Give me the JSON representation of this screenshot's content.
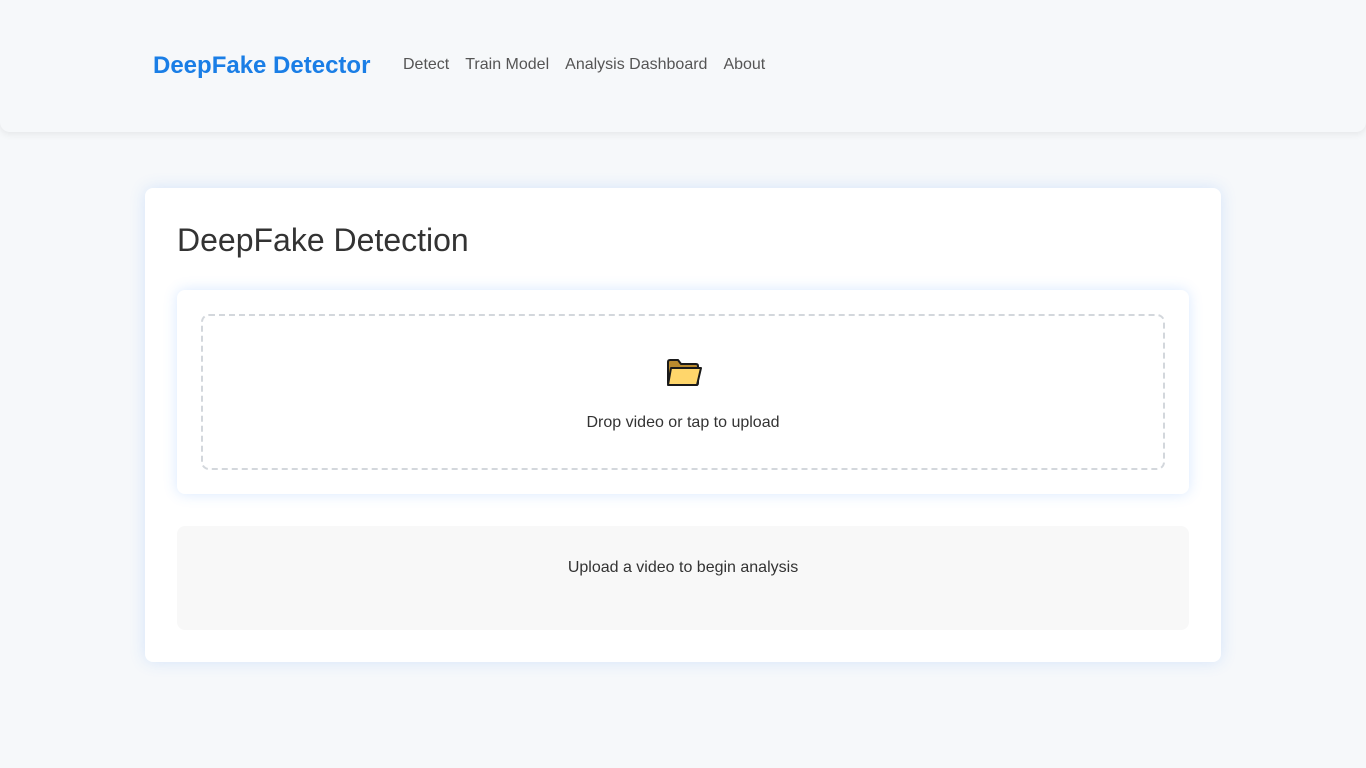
{
  "header": {
    "brand": "DeepFake Detector",
    "nav": [
      {
        "label": "Detect"
      },
      {
        "label": "Train Model"
      },
      {
        "label": "Analysis Dashboard"
      },
      {
        "label": "About"
      }
    ]
  },
  "main": {
    "title": "DeepFake Detection",
    "upload": {
      "icon": "folder-icon",
      "prompt": "Drop video or tap to upload"
    },
    "status": {
      "message": "Upload a video to begin analysis"
    }
  },
  "colors": {
    "brand": "#1a7ee6",
    "background": "#f6f8fa",
    "card": "#ffffff",
    "folder_fill": "#ffd66b"
  }
}
